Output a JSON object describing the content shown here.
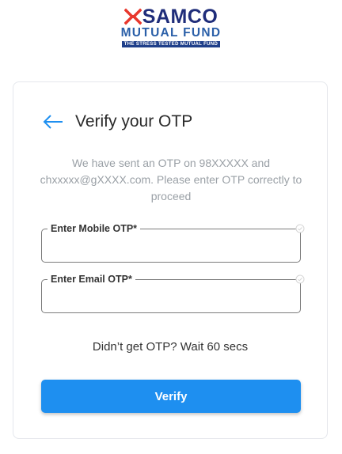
{
  "brand": {
    "name": "SAMCO",
    "subtitle": "MUTUAL FUND",
    "tagline": "THE STRESS TESTED MUTUAL FUND",
    "colors": {
      "primary": "#1f2d7a",
      "accent": "#e8372c",
      "secondary": "#2a5fa8"
    }
  },
  "header": {
    "back_icon": "arrow-left-icon",
    "title": "Verify your OTP"
  },
  "description": "We have sent an OTP on 98XXXXX and chxxxxx@gXXXX.com. Please enter OTP correctly to proceed",
  "fields": [
    {
      "label": "Enter Mobile OTP*",
      "value": "",
      "icon": "check-circle-icon"
    },
    {
      "label": "Enter Email OTP*",
      "value": "",
      "icon": "check-circle-icon"
    }
  ],
  "resend_text": "Didn’t get OTP? Wait 60 secs",
  "verify_button": {
    "label": "Verify",
    "color": "#1e8ff0"
  }
}
